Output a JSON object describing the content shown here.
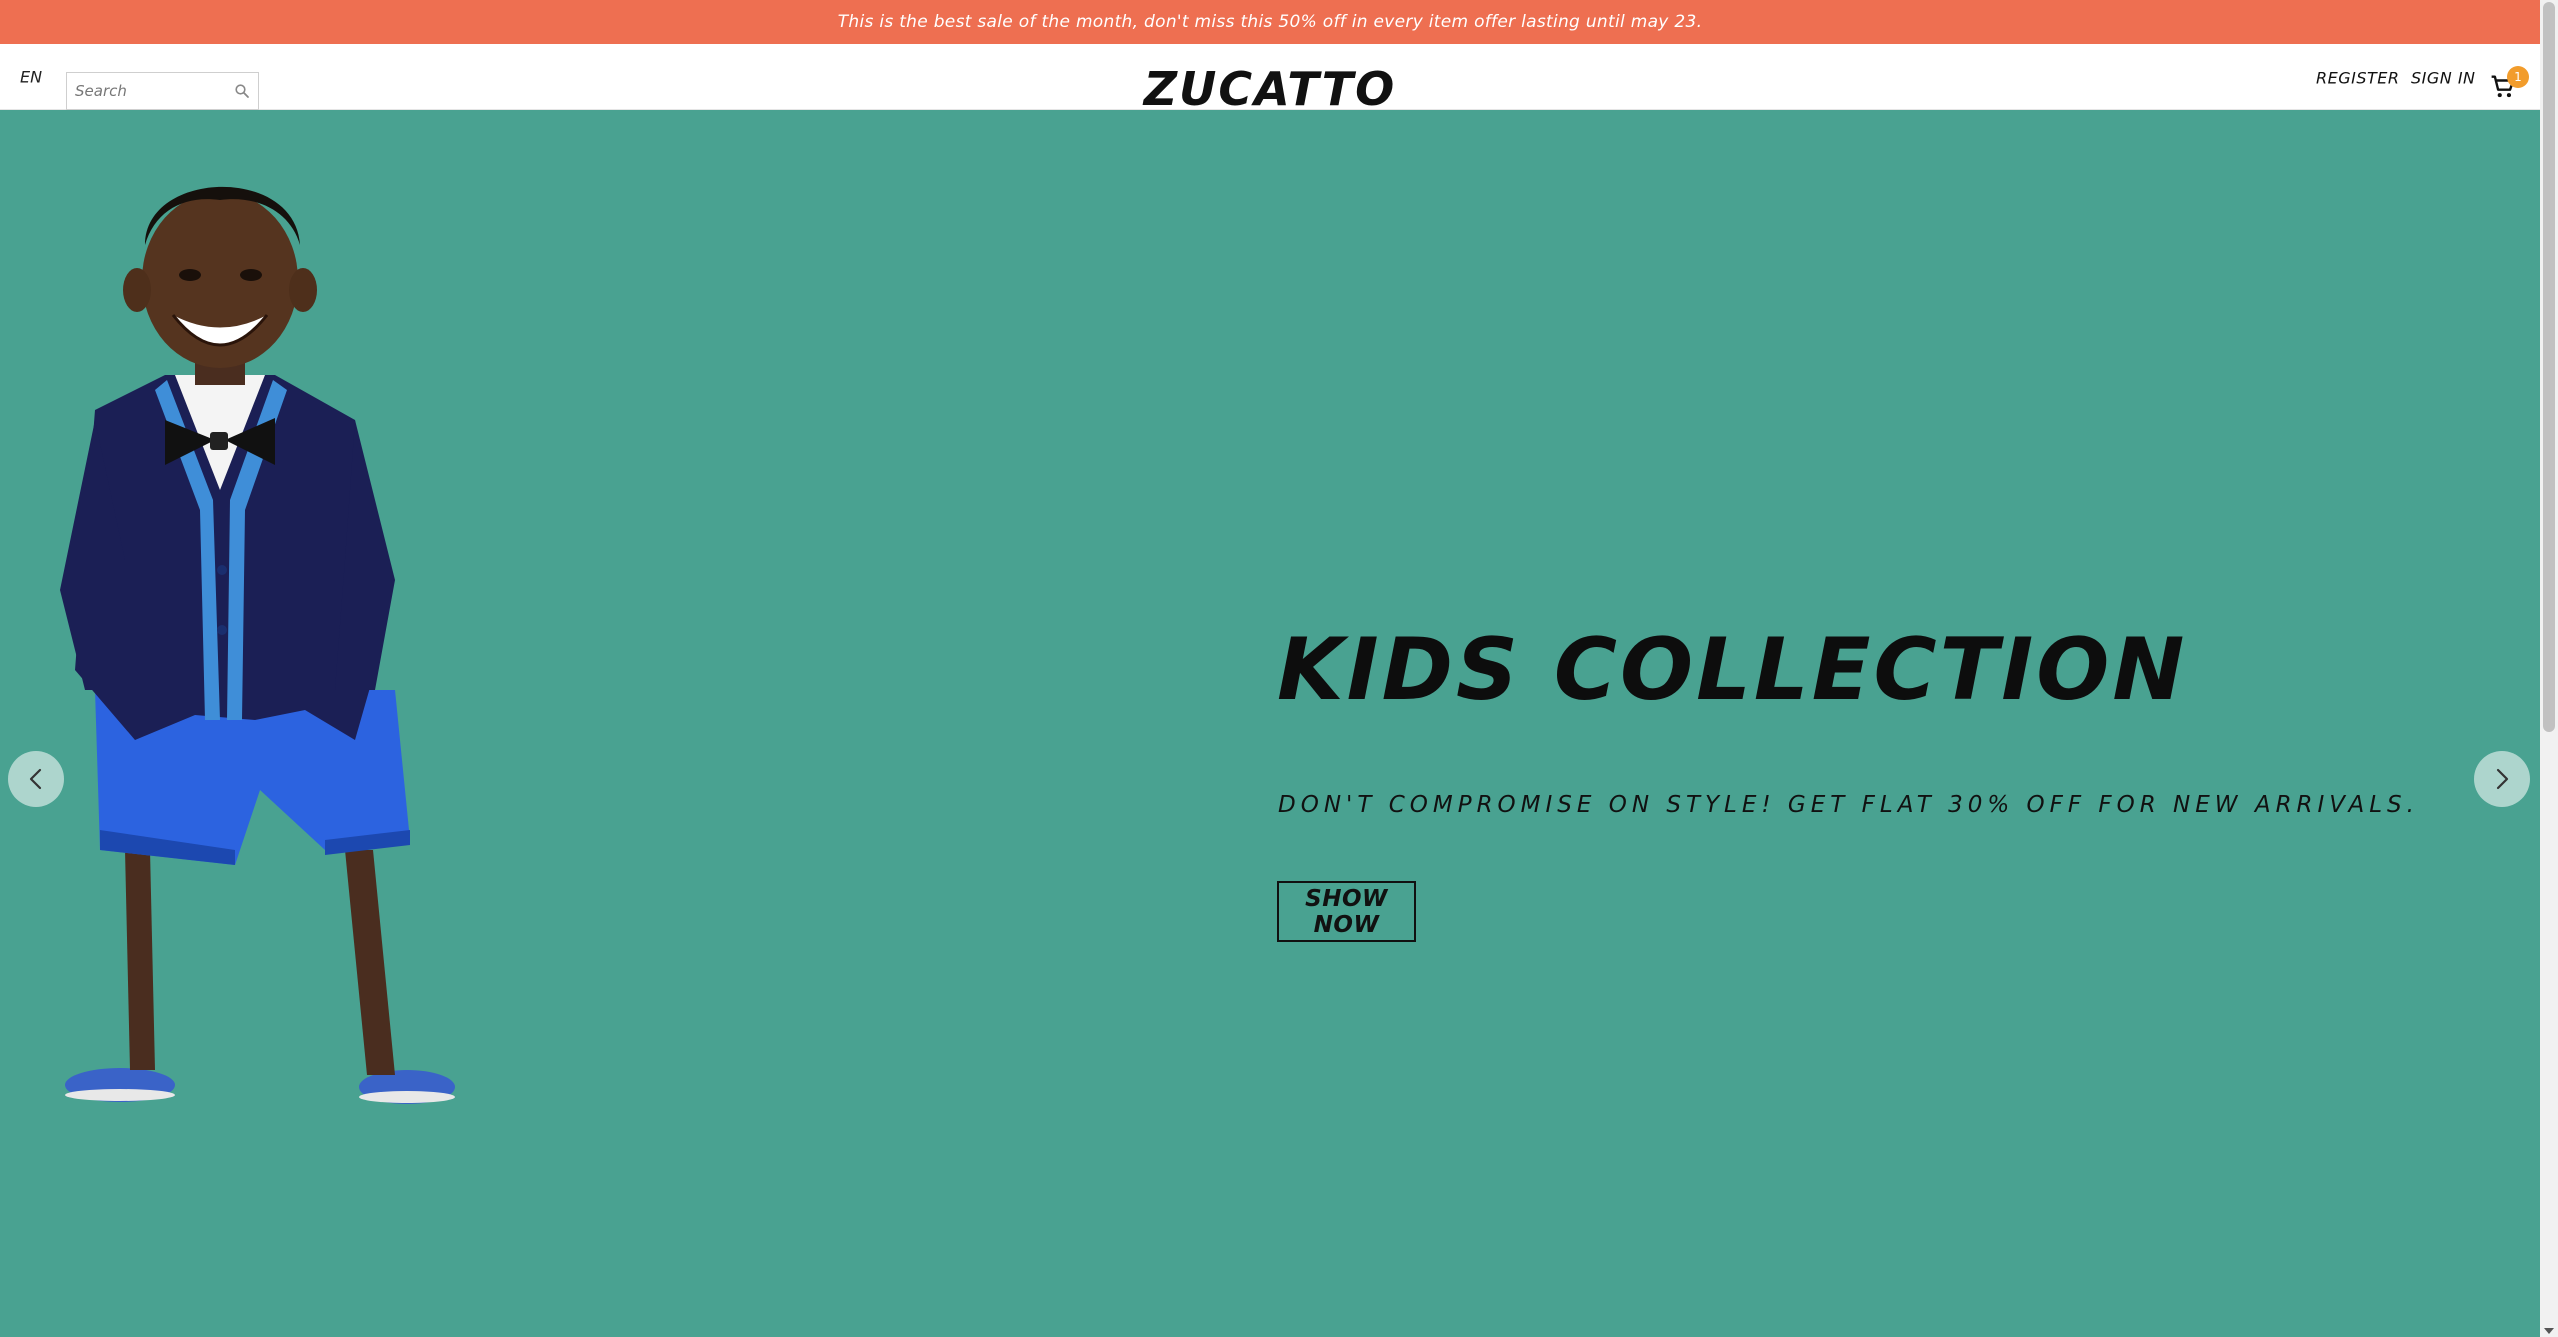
{
  "announcement": {
    "text": "This is the best sale of the month, don't miss this 50% off in every item offer lasting until may 23."
  },
  "header": {
    "language": "EN",
    "search_placeholder": "Search",
    "logo": "ZUCATTO",
    "register": "REGISTER",
    "sign_in": "SIGN IN",
    "cart_count": "1"
  },
  "hero": {
    "title": "KIDS COLLECTION",
    "subtitle": "DON'T COMPROMISE ON STYLE! GET FLAT 30% OFF FOR NEW ARRIVALS.",
    "cta": "SHOW NOW",
    "background_color": "#49a291"
  },
  "colors": {
    "announcement_bg": "#ee6f51",
    "cart_badge": "#f29c2b"
  },
  "icons": {
    "search": "search-icon",
    "cart": "cart-icon",
    "prev": "chevron-left-icon",
    "next": "chevron-right-icon"
  }
}
